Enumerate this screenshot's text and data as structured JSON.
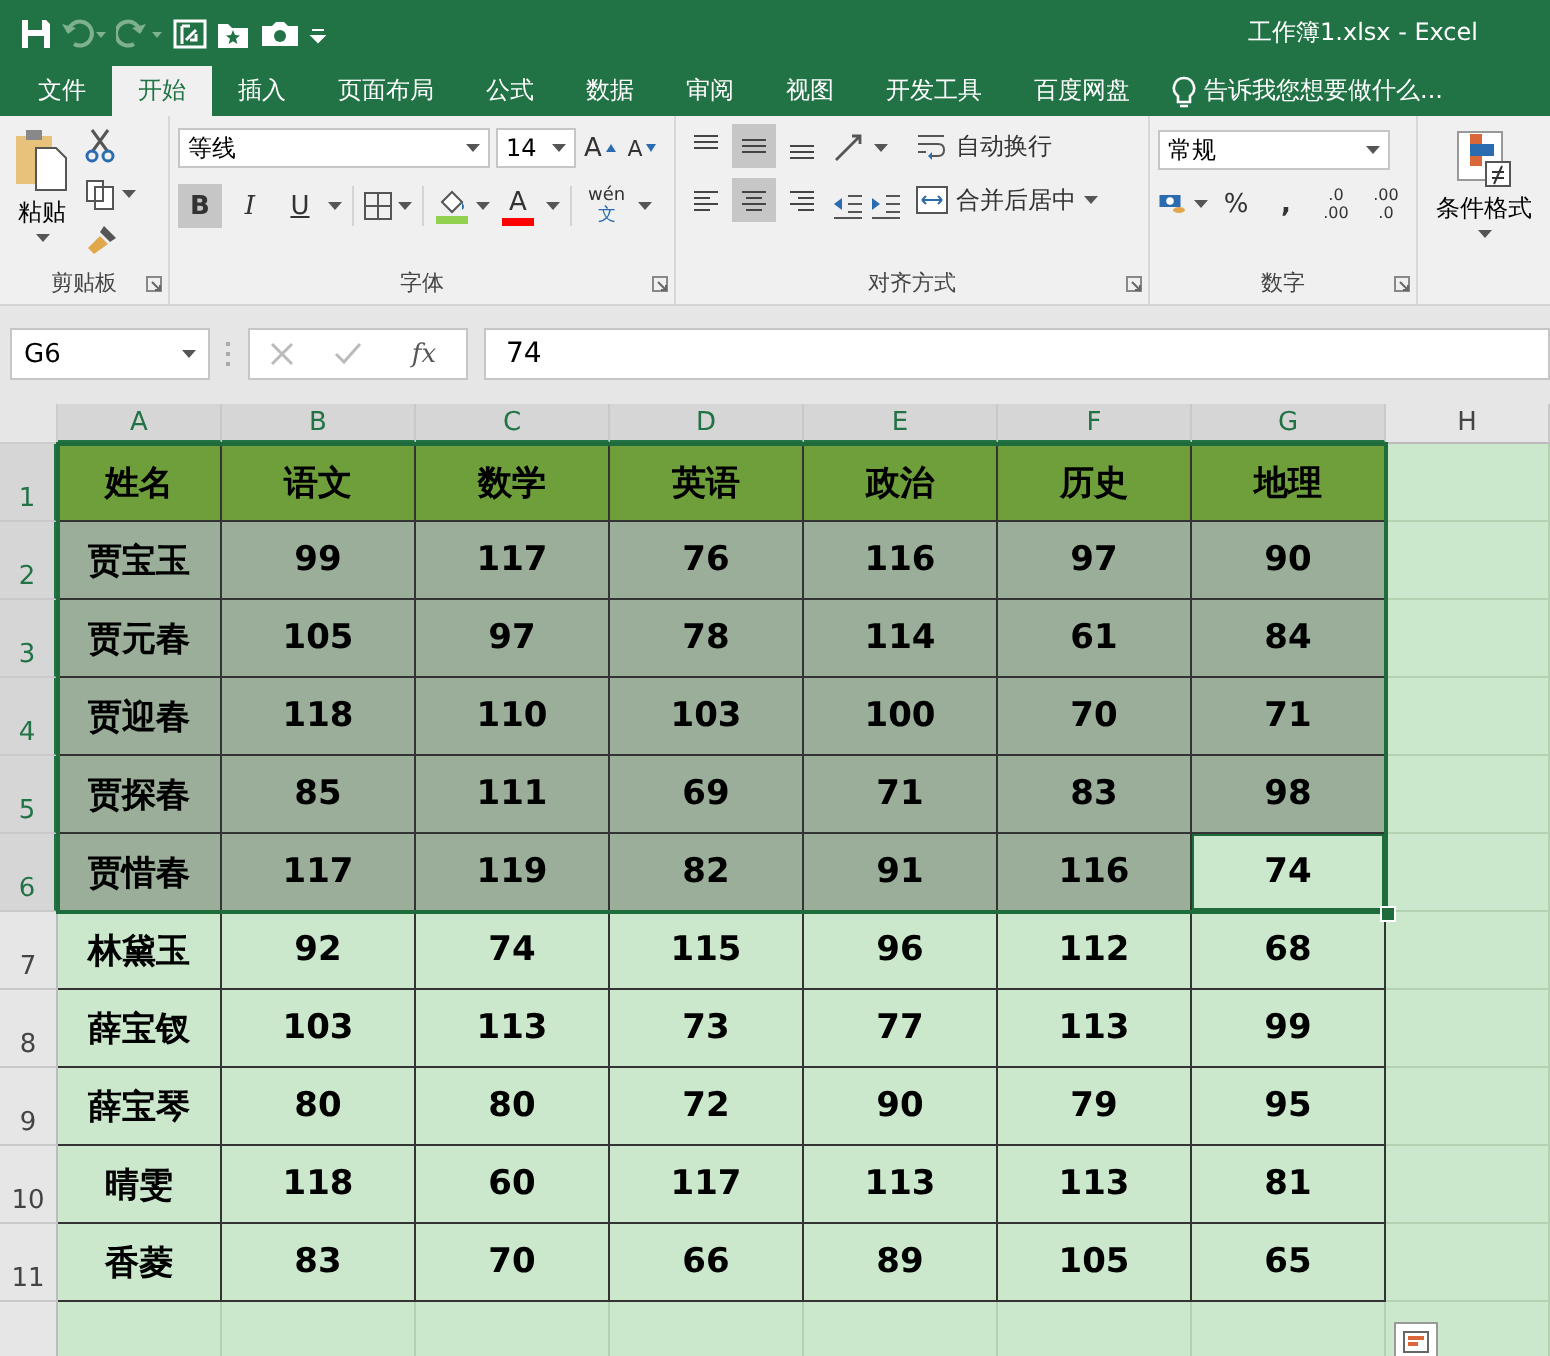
{
  "title_bar": {
    "title": "工作簿1.xlsx - Excel"
  },
  "menu_tabs": [
    {
      "label": "文件",
      "selected": false
    },
    {
      "label": "开始",
      "selected": true
    },
    {
      "label": "插入",
      "selected": false
    },
    {
      "label": "页面布局",
      "selected": false
    },
    {
      "label": "公式",
      "selected": false
    },
    {
      "label": "数据",
      "selected": false
    },
    {
      "label": "审阅",
      "selected": false
    },
    {
      "label": "视图",
      "selected": false
    },
    {
      "label": "开发工具",
      "selected": false
    },
    {
      "label": "百度网盘",
      "selected": false
    }
  ],
  "tell_me": {
    "text": "告诉我您想要做什么..."
  },
  "ribbon": {
    "clipboard": {
      "paste": "粘贴",
      "label": "剪贴板"
    },
    "font": {
      "name": "等线",
      "size": "14",
      "grow": "A",
      "shrink": "A",
      "bold": {
        "text": "B",
        "selected": true
      },
      "italic": {
        "text": "I",
        "selected": false
      },
      "underline": {
        "text": "U",
        "selected": false
      },
      "font_color": "A",
      "phonetic": [
        "wén",
        "文"
      ],
      "label": "字体"
    },
    "alignment": {
      "align_buttons": [
        {
          "kind": "top",
          "selected": false
        },
        {
          "kind": "middle",
          "selected": true
        },
        {
          "kind": "bottom",
          "selected": false
        },
        {
          "kind": "left",
          "selected": false
        },
        {
          "kind": "center",
          "selected": true
        },
        {
          "kind": "right",
          "selected": false
        }
      ],
      "wrap": "自动换行",
      "merge": "合并后居中",
      "label": "对齐方式"
    },
    "number": {
      "format": "常规",
      "percent": "%",
      "comma": ",",
      "increase_decimal": [
        ".0",
        ".00"
      ],
      "decrease_decimal": [
        ".00",
        ".0"
      ],
      "label": "数字"
    },
    "styles": {
      "conditional_format": "条件格式"
    }
  },
  "formula_bar": {
    "name_box": "G6",
    "fx": "fx",
    "value": "74"
  },
  "sheet": {
    "columns": [
      {
        "label": "A",
        "selected": true
      },
      {
        "label": "B",
        "selected": true
      },
      {
        "label": "C",
        "selected": true
      },
      {
        "label": "D",
        "selected": true
      },
      {
        "label": "E",
        "selected": true
      },
      {
        "label": "F",
        "selected": true
      },
      {
        "label": "G",
        "selected": true
      },
      {
        "label": "H",
        "selected": false
      }
    ],
    "rows": [
      {
        "header": "1",
        "selected": true,
        "kind": "header",
        "cells": [
          {
            "text": "姓名",
            "active": false
          },
          {
            "text": "语文",
            "active": false
          },
          {
            "text": "数学",
            "active": false
          },
          {
            "text": "英语",
            "active": false
          },
          {
            "text": "政治",
            "active": false
          },
          {
            "text": "历史",
            "active": false
          },
          {
            "text": "地理",
            "active": false
          }
        ]
      },
      {
        "header": "2",
        "selected": true,
        "kind": "data",
        "cells": [
          {
            "text": "贾宝玉",
            "active": false
          },
          {
            "text": "99",
            "active": false
          },
          {
            "text": "117",
            "active": false
          },
          {
            "text": "76",
            "active": false
          },
          {
            "text": "116",
            "active": false
          },
          {
            "text": "97",
            "active": false
          },
          {
            "text": "90",
            "active": false
          }
        ]
      },
      {
        "header": "3",
        "selected": true,
        "kind": "data",
        "cells": [
          {
            "text": "贾元春",
            "active": false
          },
          {
            "text": "105",
            "active": false
          },
          {
            "text": "97",
            "active": false
          },
          {
            "text": "78",
            "active": false
          },
          {
            "text": "114",
            "active": false
          },
          {
            "text": "61",
            "active": false
          },
          {
            "text": "84",
            "active": false
          }
        ]
      },
      {
        "header": "4",
        "selected": true,
        "kind": "data",
        "cells": [
          {
            "text": "贾迎春",
            "active": false
          },
          {
            "text": "118",
            "active": false
          },
          {
            "text": "110",
            "active": false
          },
          {
            "text": "103",
            "active": false
          },
          {
            "text": "100",
            "active": false
          },
          {
            "text": "70",
            "active": false
          },
          {
            "text": "71",
            "active": false
          }
        ]
      },
      {
        "header": "5",
        "selected": true,
        "kind": "data",
        "cells": [
          {
            "text": "贾探春",
            "active": false
          },
          {
            "text": "85",
            "active": false
          },
          {
            "text": "111",
            "active": false
          },
          {
            "text": "69",
            "active": false
          },
          {
            "text": "71",
            "active": false
          },
          {
            "text": "83",
            "active": false
          },
          {
            "text": "98",
            "active": false
          }
        ]
      },
      {
        "header": "6",
        "selected": true,
        "kind": "data",
        "cells": [
          {
            "text": "贾惜春",
            "active": false
          },
          {
            "text": "117",
            "active": false
          },
          {
            "text": "119",
            "active": false
          },
          {
            "text": "82",
            "active": false
          },
          {
            "text": "91",
            "active": false
          },
          {
            "text": "116",
            "active": false
          },
          {
            "text": "74",
            "active": true
          }
        ]
      },
      {
        "header": "7",
        "selected": false,
        "kind": "data",
        "cells": [
          {
            "text": "林黛玉",
            "active": false
          },
          {
            "text": "92",
            "active": false
          },
          {
            "text": "74",
            "active": false
          },
          {
            "text": "115",
            "active": false
          },
          {
            "text": "96",
            "active": false
          },
          {
            "text": "112",
            "active": false
          },
          {
            "text": "68",
            "active": false
          }
        ]
      },
      {
        "header": "8",
        "selected": false,
        "kind": "data",
        "cells": [
          {
            "text": "薛宝钗",
            "active": false
          },
          {
            "text": "103",
            "active": false
          },
          {
            "text": "113",
            "active": false
          },
          {
            "text": "73",
            "active": false
          },
          {
            "text": "77",
            "active": false
          },
          {
            "text": "113",
            "active": false
          },
          {
            "text": "99",
            "active": false
          }
        ]
      },
      {
        "header": "9",
        "selected": false,
        "kind": "data",
        "cells": [
          {
            "text": "薛宝琴",
            "active": false
          },
          {
            "text": "80",
            "active": false
          },
          {
            "text": "80",
            "active": false
          },
          {
            "text": "72",
            "active": false
          },
          {
            "text": "90",
            "active": false
          },
          {
            "text": "79",
            "active": false
          },
          {
            "text": "95",
            "active": false
          }
        ]
      },
      {
        "header": "10",
        "selected": false,
        "kind": "data",
        "cells": [
          {
            "text": "晴雯",
            "active": false
          },
          {
            "text": "118",
            "active": false
          },
          {
            "text": "60",
            "active": false
          },
          {
            "text": "117",
            "active": false
          },
          {
            "text": "113",
            "active": false
          },
          {
            "text": "113",
            "active": false
          },
          {
            "text": "81",
            "active": false
          }
        ]
      },
      {
        "header": "11",
        "selected": false,
        "kind": "data",
        "cells": [
          {
            "text": "香菱",
            "active": false
          },
          {
            "text": "83",
            "active": false
          },
          {
            "text": "70",
            "active": false
          },
          {
            "text": "66",
            "active": false
          },
          {
            "text": "89",
            "active": false
          },
          {
            "text": "105",
            "active": false
          },
          {
            "text": "65",
            "active": false
          }
        ]
      }
    ]
  }
}
